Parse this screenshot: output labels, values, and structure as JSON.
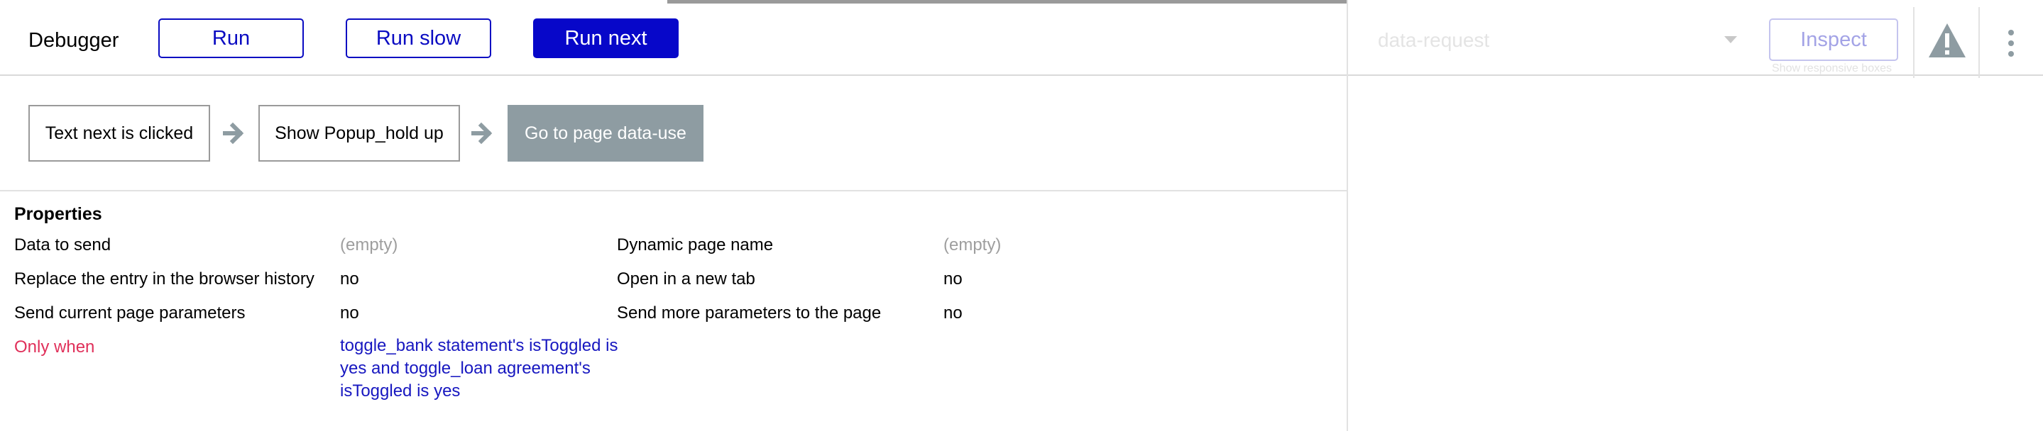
{
  "debugger": {
    "title": "Debugger",
    "buttons": {
      "run": "Run",
      "run_slow": "Run slow",
      "run_next": "Run next"
    },
    "steps": [
      {
        "label": "Text next is clicked",
        "active": false
      },
      {
        "label": "Show Popup_hold up",
        "active": false
      },
      {
        "label": "Go to page data-use",
        "active": true
      }
    ],
    "properties": {
      "heading": "Properties",
      "left": [
        {
          "label": "Data to send",
          "value": "(empty)"
        },
        {
          "label": "Replace the entry in the browser history",
          "value": "no"
        },
        {
          "label": "Send current page parameters",
          "value": "no"
        },
        {
          "label": "Only when",
          "value": "toggle_bank statement's isToggled is yes and toggle_loan agreement's isToggled is yes"
        }
      ],
      "right": [
        {
          "label": "Dynamic page name",
          "value": "(empty)"
        },
        {
          "label": "Open in a new tab",
          "value": "no"
        },
        {
          "label": "Send more parameters to the page",
          "value": "no"
        }
      ]
    }
  },
  "inspector": {
    "selected_element": "data-request",
    "inspect_label": "Inspect",
    "responsive_hint": "Show responsive boxes"
  },
  "colors": {
    "primary": "#0707c9",
    "active_step": "#8e9ca2",
    "condition_label": "#e0305a",
    "condition_value": "#1717c0"
  },
  "icons": [
    "arrow-right-icon",
    "warning-icon",
    "more-vertical-icon",
    "chevron-down-icon"
  ]
}
